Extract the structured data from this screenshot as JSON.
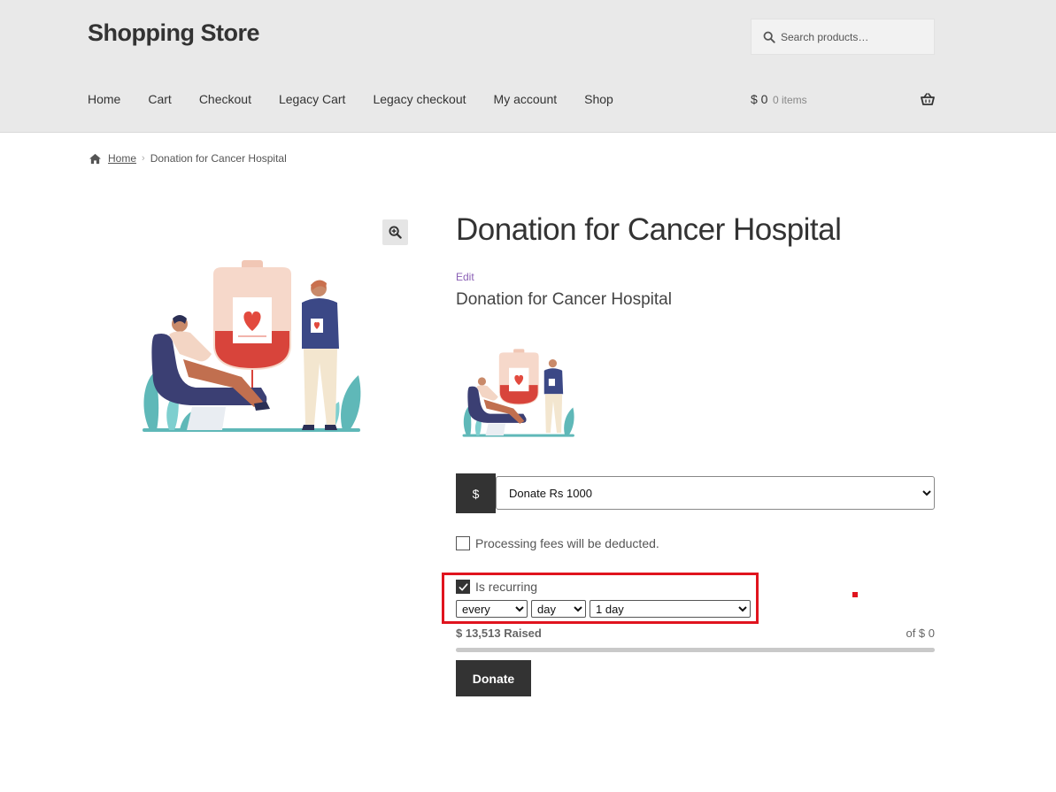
{
  "header": {
    "site_title": "Shopping Store",
    "search_placeholder": "Search products…",
    "nav": [
      "Home",
      "Cart",
      "Checkout",
      "Legacy Cart",
      "Legacy checkout",
      "My account",
      "Shop"
    ],
    "cart": {
      "amount": "$ 0",
      "count": "0 items"
    }
  },
  "breadcrumb": {
    "home": "Home",
    "current": "Donation for Cancer Hospital"
  },
  "product": {
    "title": "Donation for Cancer Hospital",
    "edit_label": "Edit",
    "subtitle": "Donation for Cancer Hospital",
    "main_image_icon": "blood-donation-illustration",
    "thumb_image_icon": "blood-donation-illustration"
  },
  "donation_form": {
    "currency_symbol": "$",
    "amount_selected": "Donate Rs 1000",
    "processing_fee_label": "Processing fees will be deducted.",
    "processing_fee_checked": false,
    "recurring_label": "Is recurring",
    "recurring_checked": true,
    "interval_selected": "every",
    "unit_selected": "day",
    "period_selected": "1 day",
    "raised_text": "$ 13,513 Raised",
    "goal_text": "of $ 0",
    "progress_fraction": 1.0,
    "donate_label": "Donate"
  },
  "colors": {
    "header_bg": "#e9e9e9",
    "button_dark": "#333333",
    "highlight_red": "#e0141e",
    "edit_link": "#8a5fb5"
  }
}
